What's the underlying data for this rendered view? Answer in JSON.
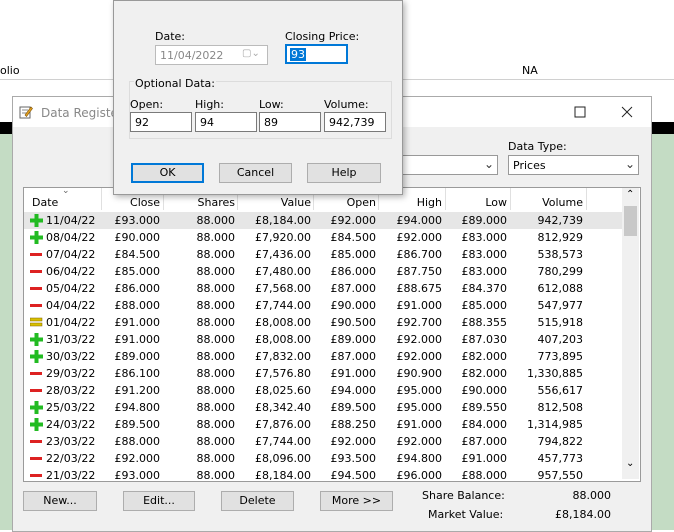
{
  "background": {
    "row_left": "olio",
    "row_mid": "NA"
  },
  "register": {
    "title": "Data Register:",
    "data_type_label": "Data Type:",
    "data_type_value": "Prices",
    "columns": [
      "Date",
      "Close",
      "Shares",
      "Value",
      "Open",
      "High",
      "Low",
      "Volume"
    ],
    "rows": [
      {
        "icon": "plus",
        "date": "11/04/22",
        "close": "£93.000",
        "shares": "88.000",
        "value": "£8,184.00",
        "open": "£92.000",
        "high": "£94.000",
        "low": "£89.000",
        "volume": "942,739"
      },
      {
        "icon": "plus",
        "date": "08/04/22",
        "close": "£90.000",
        "shares": "88.000",
        "value": "£7,920.00",
        "open": "£84.500",
        "high": "£92.000",
        "low": "£83.000",
        "volume": "812,929"
      },
      {
        "icon": "minus",
        "date": "07/04/22",
        "close": "£84.500",
        "shares": "88.000",
        "value": "£7,436.00",
        "open": "£85.000",
        "high": "£86.700",
        "low": "£83.000",
        "volume": "538,573"
      },
      {
        "icon": "minus",
        "date": "06/04/22",
        "close": "£85.000",
        "shares": "88.000",
        "value": "£7,480.00",
        "open": "£86.000",
        "high": "£87.750",
        "low": "£83.000",
        "volume": "780,299"
      },
      {
        "icon": "minus",
        "date": "05/04/22",
        "close": "£86.000",
        "shares": "88.000",
        "value": "£7,568.00",
        "open": "£87.000",
        "high": "£88.675",
        "low": "£84.370",
        "volume": "612,088"
      },
      {
        "icon": "minus",
        "date": "04/04/22",
        "close": "£88.000",
        "shares": "88.000",
        "value": "£7,744.00",
        "open": "£90.000",
        "high": "£91.000",
        "low": "£85.000",
        "volume": "547,977"
      },
      {
        "icon": "equal",
        "date": "01/04/22",
        "close": "£91.000",
        "shares": "88.000",
        "value": "£8,008.00",
        "open": "£90.500",
        "high": "£92.700",
        "low": "£88.355",
        "volume": "515,918"
      },
      {
        "icon": "plus",
        "date": "31/03/22",
        "close": "£91.000",
        "shares": "88.000",
        "value": "£8,008.00",
        "open": "£89.000",
        "high": "£92.000",
        "low": "£87.030",
        "volume": "407,203"
      },
      {
        "icon": "plus",
        "date": "30/03/22",
        "close": "£89.000",
        "shares": "88.000",
        "value": "£7,832.00",
        "open": "£87.000",
        "high": "£92.000",
        "low": "£82.000",
        "volume": "773,895"
      },
      {
        "icon": "minus",
        "date": "29/03/22",
        "close": "£86.100",
        "shares": "88.000",
        "value": "£7,576.80",
        "open": "£91.000",
        "high": "£90.900",
        "low": "£82.000",
        "volume": "1,330,885"
      },
      {
        "icon": "minus",
        "date": "28/03/22",
        "close": "£91.200",
        "shares": "88.000",
        "value": "£8,025.60",
        "open": "£94.000",
        "high": "£95.000",
        "low": "£90.000",
        "volume": "556,617"
      },
      {
        "icon": "plus",
        "date": "25/03/22",
        "close": "£94.800",
        "shares": "88.000",
        "value": "£8,342.40",
        "open": "£89.500",
        "high": "£95.000",
        "low": "£89.550",
        "volume": "812,508"
      },
      {
        "icon": "plus",
        "date": "24/03/22",
        "close": "£89.500",
        "shares": "88.000",
        "value": "£7,876.00",
        "open": "£88.250",
        "high": "£91.000",
        "low": "£84.000",
        "volume": "1,314,985"
      },
      {
        "icon": "minus",
        "date": "23/03/22",
        "close": "£88.000",
        "shares": "88.000",
        "value": "£7,744.00",
        "open": "£92.000",
        "high": "£92.000",
        "low": "£87.000",
        "volume": "794,822"
      },
      {
        "icon": "minus",
        "date": "22/03/22",
        "close": "£92.000",
        "shares": "88.000",
        "value": "£8,096.00",
        "open": "£93.500",
        "high": "£94.800",
        "low": "£91.000",
        "volume": "457,773"
      },
      {
        "icon": "minus",
        "date": "21/03/22",
        "close": "£93.000",
        "shares": "88.000",
        "value": "£8,184.00",
        "open": "£94.500",
        "high": "£96.000",
        "low": "£88.000",
        "volume": "957,550"
      }
    ],
    "buttons": {
      "new": "New...",
      "edit": "Edit...",
      "delete": "Delete",
      "more": "More >>"
    },
    "share_balance_label": "Share Balance:",
    "share_balance_value": "88.000",
    "market_value_label": "Market Value:",
    "market_value_value": "£8,184.00"
  },
  "dialog": {
    "date_label": "Date:",
    "date_value": "11/04/2022",
    "closing_price_label": "Closing Price:",
    "closing_price_value": "93",
    "optional_group_label": "Optional Data:",
    "open_label": "Open:",
    "open_value": "92",
    "high_label": "High:",
    "high_value": "94",
    "low_label": "Low:",
    "low_value": "89",
    "volume_label": "Volume:",
    "volume_value": "942,739",
    "ok_label": "OK",
    "cancel_label": "Cancel",
    "help_label": "Help"
  },
  "colors": {
    "plus": "#22bb22",
    "minus": "#dd2222",
    "equal": "#d8c000",
    "selected_row": "#e6e6e6"
  }
}
